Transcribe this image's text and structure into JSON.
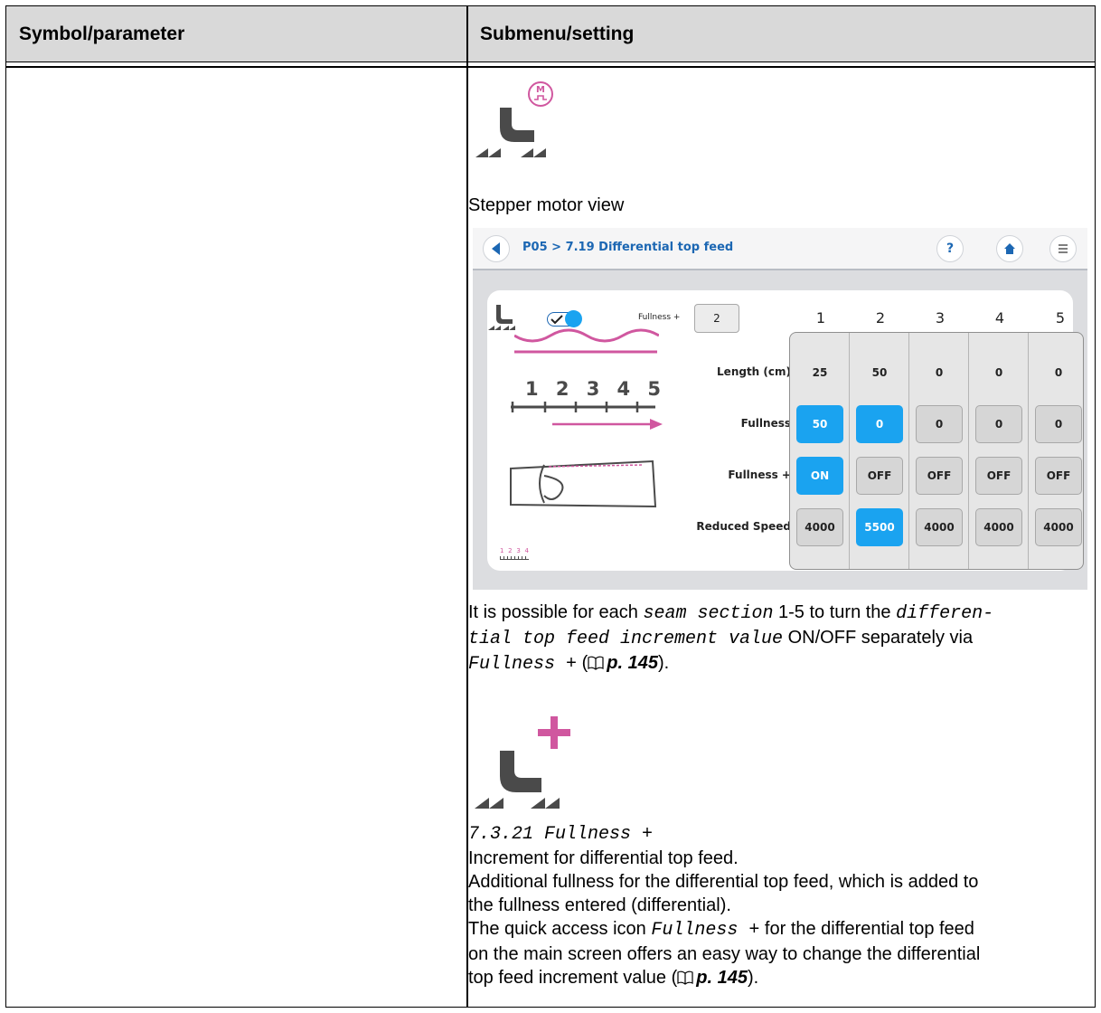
{
  "table": {
    "col1_header": "Symbol/parameter",
    "col2_header": "Submenu/setting"
  },
  "content": {
    "stepper_caption": "Stepper motor view",
    "para1": {
      "t1": "It is possible for each ",
      "m1": "seam section",
      "t2": " 1-5 to turn the ",
      "m2": "differen-",
      "m3": "tial top feed increment value",
      "t3": " ON/OFF separately via",
      "m4": "Fullness +",
      "t4": " (",
      "ref": "p. 145",
      "t5": ")."
    },
    "section_heading": "7.3.21 Fullness +",
    "desc_line1": "Increment for differential top feed.",
    "desc_line2": "Additional fullness for the differential top feed, which is added to",
    "desc_line3": "the fullness entered (differential).",
    "desc_line4a": "The quick access icon ",
    "desc_line4m": "Fullness +",
    "desc_line4b": " for the differential top feed",
    "desc_line5": "on the main screen offers an easy way to change the differential",
    "desc_line6a": "top feed increment value (",
    "desc_line6ref": "p. 145",
    "desc_line6b": ")."
  },
  "app": {
    "breadcrumb": "P05 > 7.19 Differential top feed",
    "help_label": "?",
    "fullness_plus_label": "Fullness +",
    "fullness_plus_value": "2",
    "ruler_numbers": [
      "1",
      "2",
      "3",
      "4",
      "5"
    ],
    "columns": [
      "1",
      "2",
      "3",
      "4",
      "5"
    ],
    "row_labels": {
      "length": "Length (cm)",
      "fullness": "Fullness",
      "fullness_plus": "Fullness +",
      "reduced_speed": "Reduced Speed"
    },
    "length": [
      "25",
      "50",
      "0",
      "0",
      "0"
    ],
    "fullness": [
      "50",
      "0",
      "0",
      "0",
      "0"
    ],
    "fullness_plus": [
      "ON",
      "OFF",
      "OFF",
      "OFF",
      "OFF"
    ],
    "reduced_speed": [
      "4000",
      "5500",
      "4000",
      "4000",
      "4000"
    ],
    "mini_ruler": [
      "1",
      "2",
      "3",
      "4"
    ],
    "accent_blue": "#1aa3f0",
    "accent_magenta": "#d0579f"
  },
  "icons": {
    "motor_badge_text": "M"
  }
}
